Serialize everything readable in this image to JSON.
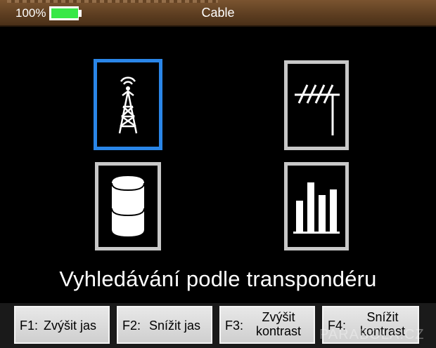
{
  "status_bar": {
    "battery_percent": "100%",
    "title": "Cable",
    "battery_level": 1.0,
    "battery_color": "#38e848"
  },
  "menu": {
    "tiles": [
      {
        "icon": "broadcast-tower-icon",
        "selected": true
      },
      {
        "icon": "tv-antenna-icon",
        "selected": false
      },
      {
        "icon": "database-icon",
        "selected": false
      },
      {
        "icon": "spectrum-bars-icon",
        "selected": false
      }
    ],
    "selected_color": "#2a86e8",
    "caption": "Vyhledávání podle transpondéru"
  },
  "function_keys": [
    {
      "key": "F1:",
      "label": "Zvýšit jas"
    },
    {
      "key": "F2:",
      "label": "Snížit jas"
    },
    {
      "key": "F3:",
      "label_line1": "Zvýšit",
      "label_line2": "kontrast"
    },
    {
      "key": "F4:",
      "label_line1": "Snížit",
      "label_line2": "kontrast"
    }
  ],
  "watermark": "PARABOLA.CZ"
}
